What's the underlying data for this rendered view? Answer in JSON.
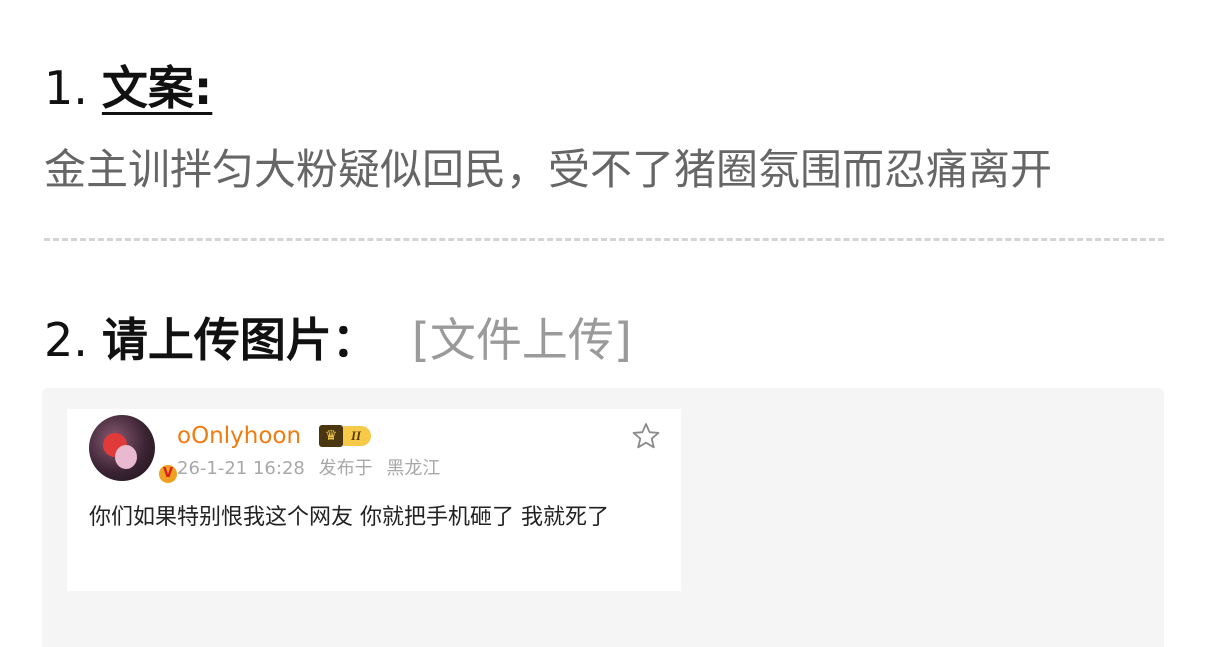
{
  "question1": {
    "number": "1.",
    "label": "文案:",
    "answer": "金主训拌匀大粉疑似回民，受不了猪圈氛围而忍痛离开"
  },
  "question2": {
    "number": "2.",
    "label": "请上传图片：",
    "upload_link": "[文件上传]"
  },
  "post": {
    "username": "oOnlyhoon",
    "rank_badge": "II",
    "timestamp": "26-1-21 16:28",
    "published_at_label": "发布于",
    "location": "黑龙江",
    "text": "你们如果特别恨我这个网友 你就把手机砸了 我就死了",
    "icons": {
      "verified": "verified-badge-icon",
      "favorite": "star-icon",
      "crown": "crown-icon"
    }
  },
  "colors": {
    "username": "#f07c10",
    "upload_link": "#9a9a9a",
    "area_bg": "#f5f5f5"
  }
}
